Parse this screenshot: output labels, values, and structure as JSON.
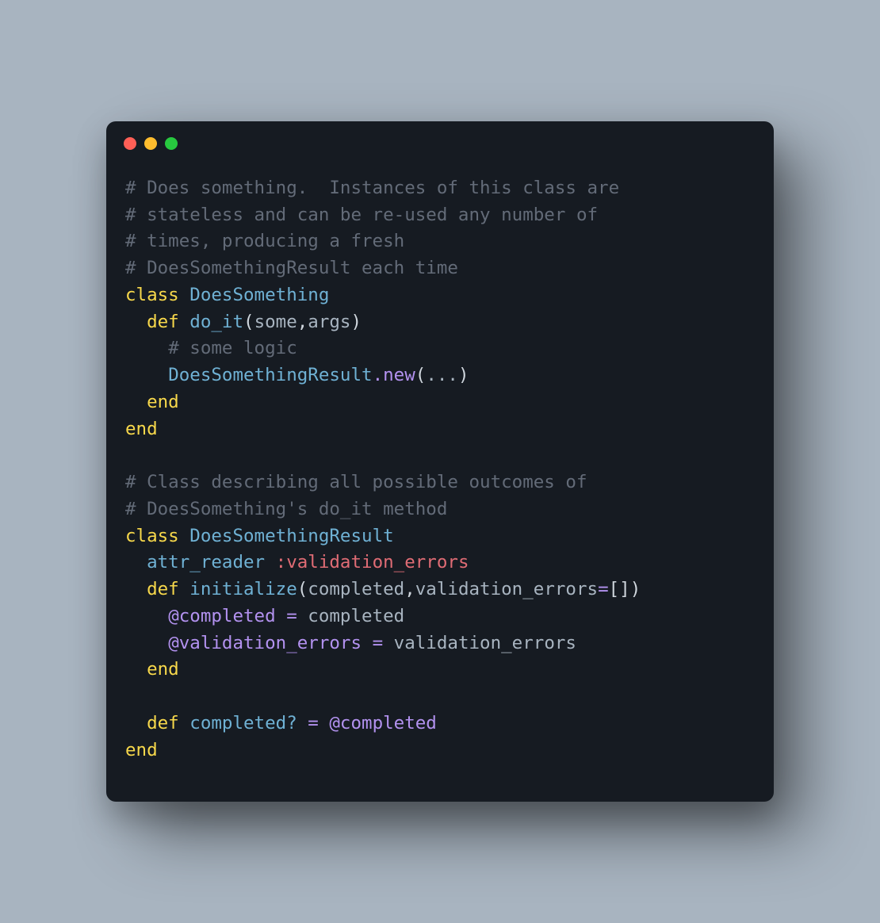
{
  "traffic_lights": {
    "red": "#ff5f56",
    "yellow": "#ffbd2e",
    "green": "#27c93f"
  },
  "code": {
    "l1": "# Does something.  Instances of this class are",
    "l2": "# stateless and can be re-used any number of",
    "l3": "# times, producing a fresh",
    "l4": "# DoesSomethingResult each time",
    "l5_kw_class": "class",
    "l5_cls": "DoesSomething",
    "l6_kw_def": "def",
    "l6_fn": "do_it",
    "l6_a1": "some",
    "l6_a2": "args",
    "l7": "# some logic",
    "l8_cls": "DoesSomethingResult",
    "l8_new": "new",
    "l8_args": "...",
    "l9_end": "end",
    "l10_end": "end",
    "l12": "# Class describing all possible outcomes of",
    "l13": "# DoesSomething's do_it method",
    "l14_kw_class": "class",
    "l14_cls": "DoesSomethingResult",
    "l15_attr": "attr_reader",
    "l15_sym": ":validation_errors",
    "l16_kw_def": "def",
    "l16_fn": "initialize",
    "l16_a1": "completed",
    "l16_a2": "validation_errors",
    "l16_default": "[]",
    "l17_ivar": "@completed",
    "l17_eq": "=",
    "l17_val": "completed",
    "l18_ivar": "@validation_errors",
    "l18_eq": "=",
    "l18_val": "validation_errors",
    "l19_end": "end",
    "l21_kw_def": "def",
    "l21_fn": "completed?",
    "l21_eq": "=",
    "l21_ivar": "@completed",
    "l22_end": "end"
  }
}
